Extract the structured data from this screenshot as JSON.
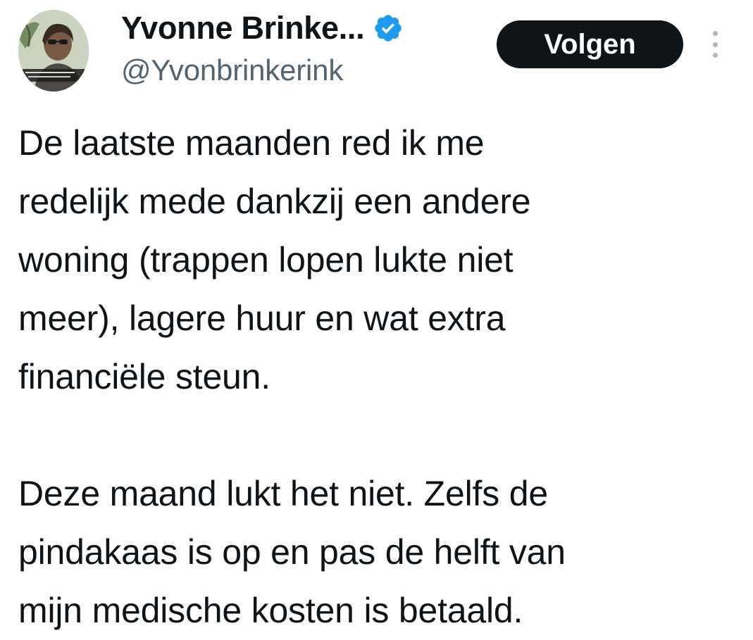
{
  "author": {
    "display_name": "Yvonne Brinke...",
    "handle": "@Yvonbrinkerink",
    "verified": true
  },
  "actions": {
    "follow_label": "Volgen"
  },
  "tweet": {
    "paragraphs": [
      {
        "lines": [
          "De laatste maanden red ik me",
          "redelijk mede dankzij een andere",
          "woning (trappen lopen lukte niet",
          "meer), lagere huur en wat extra",
          "financiële steun."
        ]
      },
      {
        "lines": [
          "Deze maand lukt het niet. Zelfs de",
          "pindakaas is op en pas de helft van",
          "mijn medische kosten is betaald."
        ]
      }
    ]
  },
  "icons": {
    "verified": "verified-badge-icon",
    "more": "more-options-icon"
  },
  "colors": {
    "verified_blue": "#1d9bf0",
    "button_bg": "#0f1419",
    "handle_gray": "#536471",
    "text": "#0f1419"
  }
}
